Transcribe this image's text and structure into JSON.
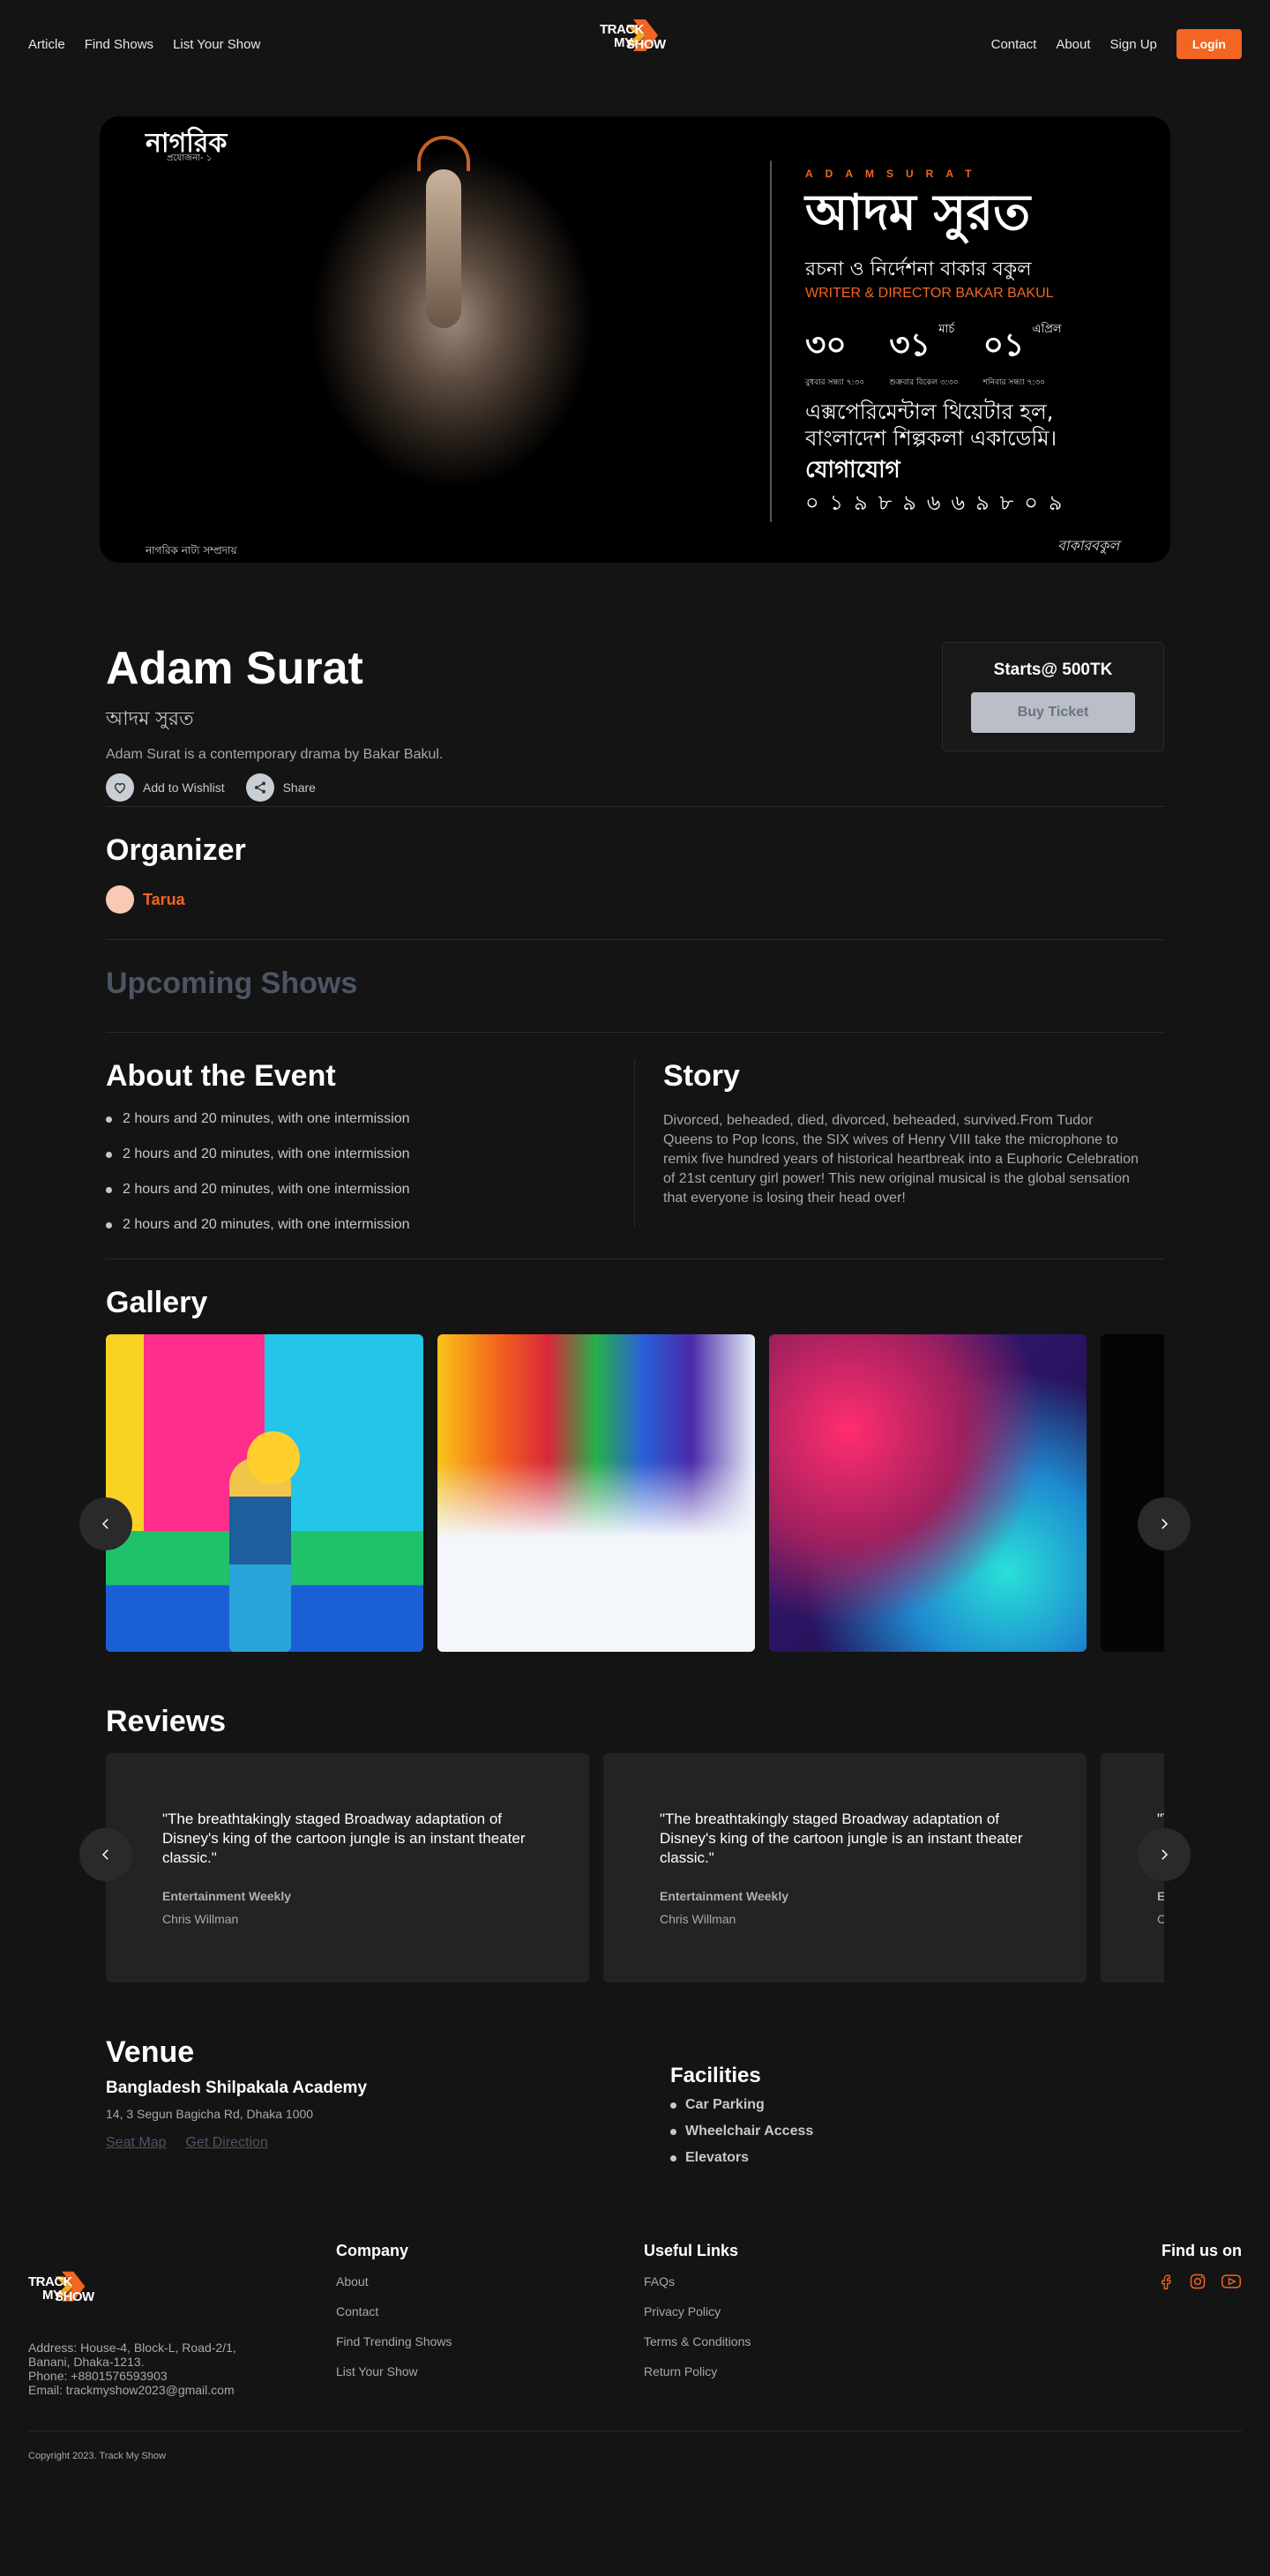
{
  "nav": {
    "links": [
      "Article",
      "Find Shows",
      "List Your Show"
    ],
    "right_links": [
      "Contact",
      "About",
      "Sign Up"
    ],
    "login_label": "Login",
    "logo_lines": [
      "TRACK",
      "MY",
      "SHOW"
    ]
  },
  "poster": {
    "brand": "নাগরিক",
    "brand_sub": "প্রযোজনা- ১",
    "topline": "ADAMSURAT",
    "title_bn": "আদম সুরত",
    "credit_bn": "রচনা ও নির্দেশনা   বাকার বকুল",
    "credit_en": "WRITER & DIRECTOR   BAKAR BAKUL",
    "dates": [
      {
        "num": "৩০",
        "month": "",
        "day": "বুধবার সন্ধ্যা ৭:৩০"
      },
      {
        "num": "৩১",
        "month": "মার্চ",
        "day": "শুক্রবার বিকেল ৩:৩০"
      },
      {
        "num": "০১",
        "month": "এপ্রিল",
        "day": "শনিবার সন্ধ্যা ৭:৩০"
      }
    ],
    "venue_line1": "এক্সপেরিমেন্টাল থিয়েটার হল,",
    "venue_line2": "বাংলাদেশ শিল্পকলা একাডেমি।",
    "contact_label": "যোগাযোগ",
    "phone": "০১৯৮৯৬৬৯৮০৯",
    "footer_left": "নাগরিক নাট্য সম্প্রদায়",
    "signature": "বাকারবকুল"
  },
  "event": {
    "title": "Adam Surat",
    "title_bn": "আদম সুরত",
    "description": "Adam Surat is a contemporary drama by Bakar Bakul.",
    "wishlist_label": "Add to Wishlist",
    "share_label": "Share",
    "price_label": "Starts@ 500TK",
    "buy_label": "Buy Ticket"
  },
  "organizer": {
    "heading": "Organizer",
    "name": "Tarua"
  },
  "upcoming": {
    "heading": "Upcoming Shows"
  },
  "about": {
    "heading": "About the Event",
    "items": [
      "2 hours and 20 minutes, with one intermission",
      "2 hours and 20 minutes, with one intermission",
      "2 hours and 20 minutes, with one intermission",
      "2 hours and 20 minutes, with one intermission"
    ]
  },
  "story": {
    "heading": "Story",
    "text": "Divorced, beheaded, died, divorced, beheaded, survived.From Tudor Queens to Pop Icons, the SIX wives of Henry VIII take the microphone to remix five hundred years of historical heartbreak into a Euphoric Celebration of 21st century girl power! This new original musical is the global sensation that everyone is losing their head over!"
  },
  "gallery": {
    "heading": "Gallery"
  },
  "reviews": {
    "heading": "Reviews",
    "items": [
      {
        "quote": "\"The breathtakingly staged Broadway adaptation of Disney's king of the cartoon jungle is an instant theater classic.\"",
        "publication": "Entertainment Weekly",
        "author": "Chris Willman"
      },
      {
        "quote": "\"The breathtakingly staged Broadway adaptation of Disney's king of the cartoon jungle is an instant theater classic.\"",
        "publication": "Entertainment Weekly",
        "author": "Chris Willman"
      },
      {
        "quote": "\"The breathtakingly staged Broadway adaptation of Disney's king of the cartoon jungle is an instant theater classic.\"",
        "publication": "Entertainment Weekly",
        "author": "Chris Willman"
      }
    ]
  },
  "venue": {
    "heading": "Venue",
    "name": "Bangladesh Shilpakala Academy",
    "address": "14, 3 Segun Bagicha Rd, Dhaka 1000",
    "seat_map_label": "Seat Map",
    "direction_label": "Get Direction",
    "facilities_heading": "Facilities",
    "facilities": [
      "Car Parking",
      "Wheelchair Access",
      "Elevators"
    ]
  },
  "footer": {
    "address_line": "Address: House-4, Block-L, Road-2/1, Banani, Dhaka-1213.",
    "phone_line": "Phone:  +8801576593903",
    "email_line": "Email:  trackmyshow2023@gmail.com",
    "company_heading": "Company",
    "company_links": [
      "About",
      "Contact",
      "Find Trending Shows",
      "List Your Show"
    ],
    "useful_heading": "Useful Links",
    "useful_links": [
      "FAQs",
      "Privacy Policy",
      "Terms & Conditions",
      "Return Policy"
    ],
    "social_heading": "Find us on",
    "copyright": "Copyright 2023. Track My Show"
  },
  "colors": {
    "accent": "#f26522",
    "background": "#141414",
    "card": "#232323"
  },
  "icons": [
    "heart-icon",
    "share-icon",
    "chevron-left-icon",
    "chevron-right-icon",
    "facebook-icon",
    "instagram-icon",
    "youtube-icon"
  ]
}
